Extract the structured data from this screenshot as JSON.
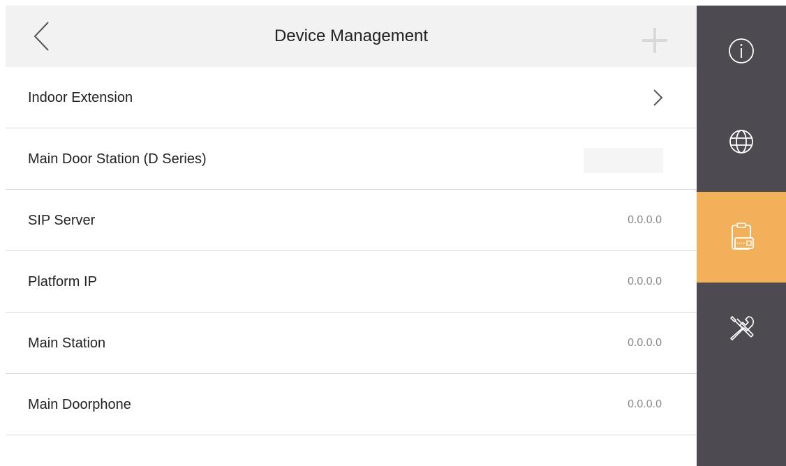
{
  "header": {
    "title": "Device Management",
    "back_icon": "chevron-left-icon",
    "add_icon": "plus-icon"
  },
  "rows": [
    {
      "label": "Indoor Extension",
      "value": "",
      "trailing": "chevron-right-icon"
    },
    {
      "label": "Main Door Station (D Series)",
      "value": "",
      "trailing": "blank-field"
    },
    {
      "label": "SIP Server",
      "value": "0.0.0.0"
    },
    {
      "label": "Platform IP",
      "value": "0.0.0.0"
    },
    {
      "label": "Main Station",
      "value": "0.0.0.0"
    },
    {
      "label": "Main Doorphone",
      "value": "0.0.0.0"
    }
  ],
  "sidebar": {
    "items": [
      {
        "icon": "info-icon",
        "active": false
      },
      {
        "icon": "globe-icon",
        "active": false
      },
      {
        "icon": "device-management-icon",
        "active": true
      },
      {
        "icon": "tools-icon",
        "active": false
      }
    ]
  },
  "colors": {
    "sidebar_bg": "#4d4a52",
    "sidebar_active": "#f2b05a",
    "header_bg": "#f2f2f2",
    "value_text": "#8a8a8a"
  }
}
